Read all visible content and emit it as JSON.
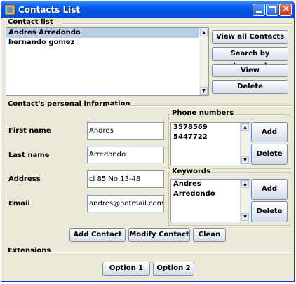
{
  "window": {
    "title": "Contacts List"
  },
  "contact_list": {
    "label": "Contact list",
    "items": [
      "Andres Arredondo",
      "hernando gomez"
    ],
    "selected": "Andres Arredondo"
  },
  "list_actions": {
    "view_all": "View all Contacts",
    "search": "Search by keyword",
    "view": "View",
    "delete": "Delete"
  },
  "personal": {
    "label": "Contact's personal information",
    "first_name": {
      "label": "First name",
      "value": "Andres"
    },
    "last_name": {
      "label": "Last name",
      "value": "Arredondo"
    },
    "address": {
      "label": "Address",
      "value": "cl 85 No 13-48"
    },
    "email": {
      "label": "Email",
      "value": "andres@hotmail.com"
    }
  },
  "phones": {
    "label": "Phone numbers",
    "items": [
      "3578569",
      "5447722"
    ],
    "add": "Add",
    "delete": "Delete"
  },
  "keywords": {
    "label": "Keywords",
    "items": [
      "Andres",
      "Arredondo"
    ],
    "add": "Add",
    "delete": "Delete"
  },
  "form_actions": {
    "add_contact": "Add Contact",
    "modify_contact": "Modify Contact",
    "clean": "Clean"
  },
  "extensions": {
    "label": "Extensions",
    "option1": "Option 1",
    "option2": "Option 2"
  },
  "colors": {
    "titlebar": "#0153e3",
    "selection": "#b8cfe5",
    "window_bg": "#ece9d8"
  }
}
